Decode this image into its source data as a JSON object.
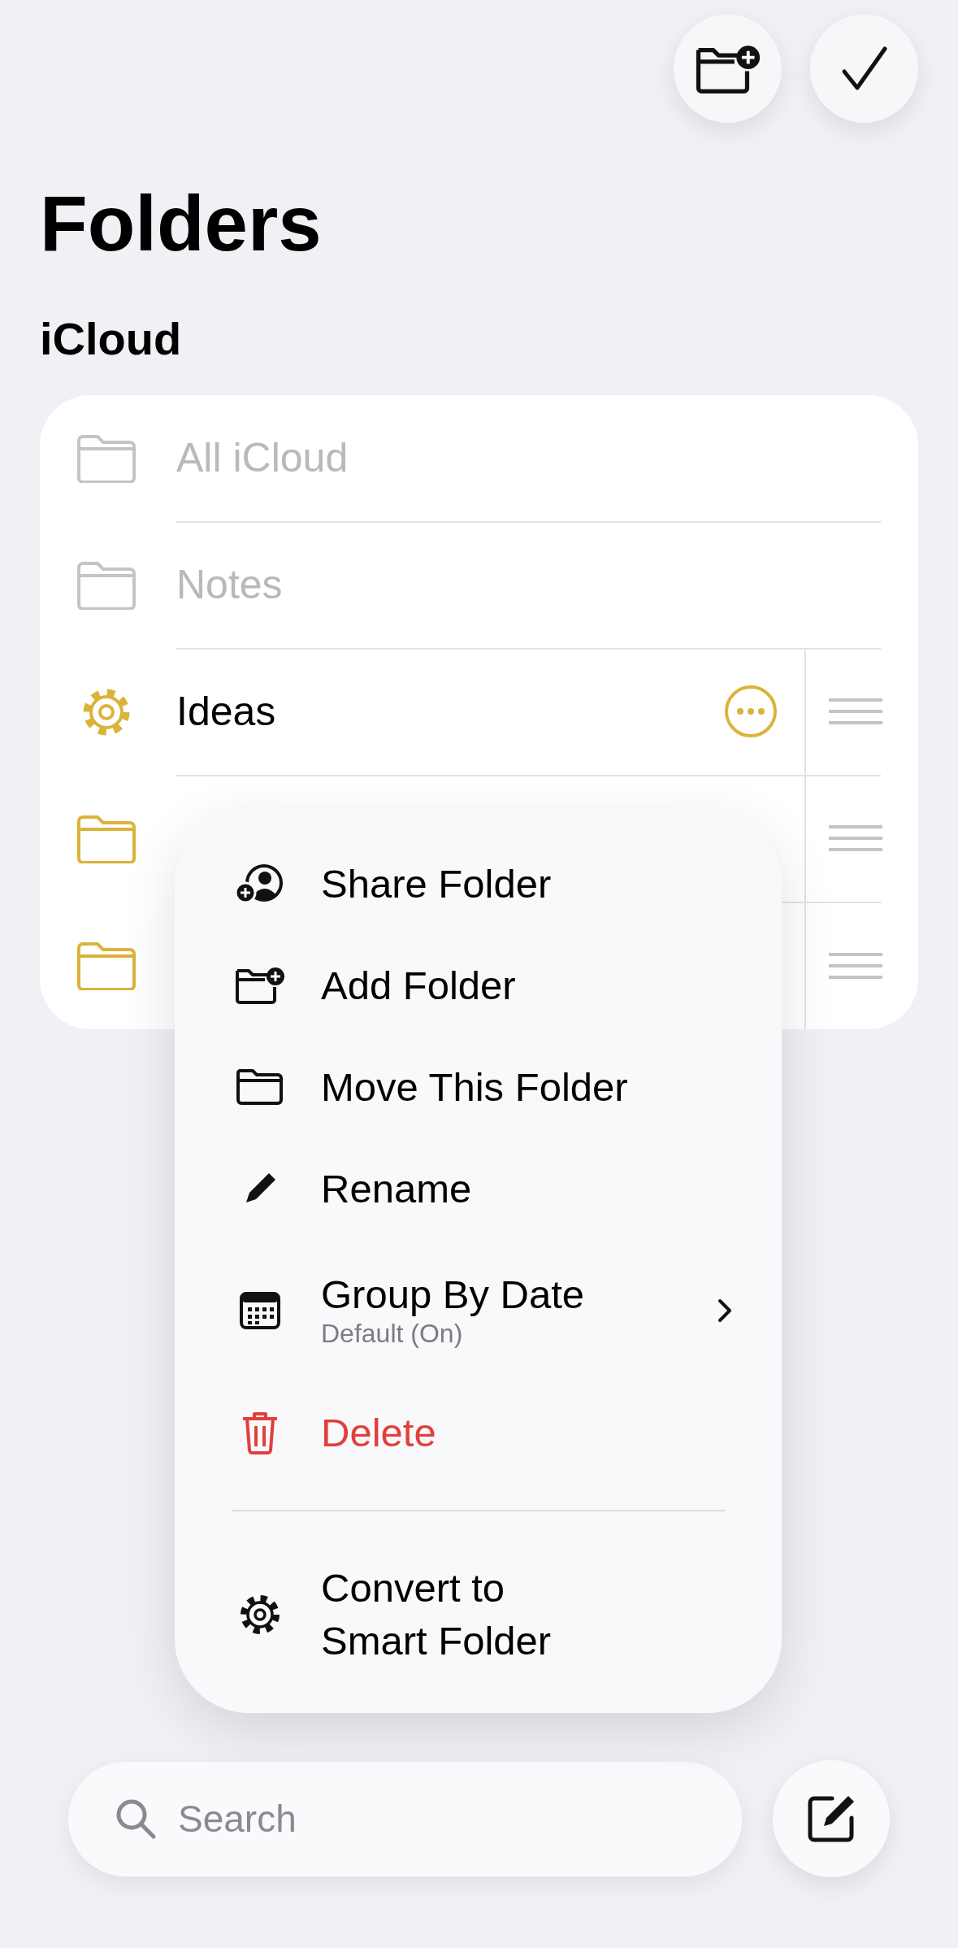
{
  "title": "Folders",
  "section": "iCloud",
  "folders": [
    {
      "name": "All iCloud",
      "kind": "folder",
      "disabled": true,
      "actions": false
    },
    {
      "name": "Notes",
      "kind": "folder",
      "disabled": true,
      "actions": false
    },
    {
      "name": "Ideas",
      "kind": "smart",
      "disabled": false,
      "actions": true
    },
    {
      "kind": "folder",
      "disabled": false
    },
    {
      "kind": "folder",
      "disabled": false
    }
  ],
  "menu": [
    {
      "label": "Share Folder",
      "kind": "action"
    },
    {
      "label": "Add Folder",
      "kind": "action"
    },
    {
      "label": "Move This Folder",
      "kind": "action"
    },
    {
      "label": "Rename",
      "kind": "action"
    },
    {
      "label": "Group By Date",
      "subtitle": "Default (On)",
      "kind": "submenu"
    },
    {
      "label": "Delete",
      "kind": "destructive"
    },
    {
      "label": "Convert to Smart Folder",
      "kind": "separated"
    }
  ],
  "search": {
    "placeholder": "Search"
  }
}
